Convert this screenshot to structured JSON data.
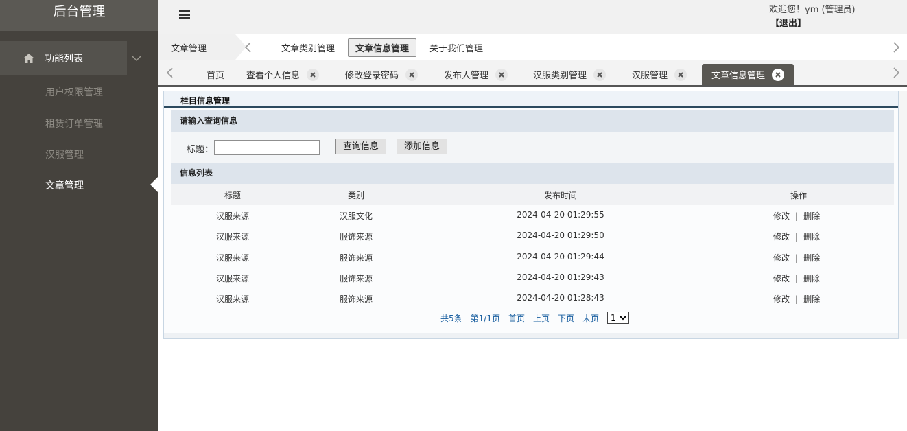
{
  "sidebar": {
    "brand": "后台管理",
    "section_label": "功能列表",
    "items": [
      {
        "label": "用户权限管理"
      },
      {
        "label": "租赁订单管理"
      },
      {
        "label": "汉服管理"
      },
      {
        "label": "文章管理"
      }
    ],
    "active_index": 3
  },
  "header": {
    "welcome": "欢迎您！ym (管理员)",
    "logout": "【退出】"
  },
  "subnav": {
    "breadcrumb": "文章管理",
    "links": [
      {
        "label": "文章类别管理"
      },
      {
        "label": "文章信息管理",
        "active": true
      },
      {
        "label": "关于我们管理"
      }
    ]
  },
  "tabs": [
    {
      "label": "首页",
      "closable": false
    },
    {
      "label": "查看个人信息",
      "closable": true
    },
    {
      "label": "修改登录密码",
      "closable": true
    },
    {
      "label": "发布人管理",
      "closable": true
    },
    {
      "label": "汉服类别管理",
      "closable": true
    },
    {
      "label": "汉服管理",
      "closable": true
    },
    {
      "label": "文章信息管理",
      "closable": true,
      "active": true
    }
  ],
  "panel": {
    "title": "栏目信息管理",
    "query_heading": "请输入查询信息",
    "search_label": "标题：",
    "search_value": "",
    "query_button": "查询信息",
    "add_button": "添加信息",
    "list_heading": "信息列表"
  },
  "table": {
    "columns": [
      "标题",
      "类别",
      "发布时间",
      "操作"
    ],
    "rows": [
      {
        "title": "汉服来源",
        "category": "汉服文化",
        "time": "2024-04-20 01:29:55"
      },
      {
        "title": "汉服来源",
        "category": "服饰来源",
        "time": "2024-04-20 01:29:50"
      },
      {
        "title": "汉服来源",
        "category": "服饰来源",
        "time": "2024-04-20 01:29:44"
      },
      {
        "title": "汉服来源",
        "category": "服饰来源",
        "time": "2024-04-20 01:29:43"
      },
      {
        "title": "汉服来源",
        "category": "服饰来源",
        "time": "2024-04-20 01:28:43"
      }
    ],
    "edit_label": "修改",
    "separator": "|",
    "delete_label": "删除"
  },
  "pager": {
    "total": "共5条",
    "page_info": "第1/1页",
    "first": "首页",
    "prev": "上页",
    "next": "下页",
    "last": "末页",
    "current_page": "1"
  },
  "colors": {
    "sidebar_bg": "#45423d",
    "active_tab_bg": "#595752",
    "link_blue": "#1a5fa0",
    "section_bg": "#dde4ec"
  }
}
